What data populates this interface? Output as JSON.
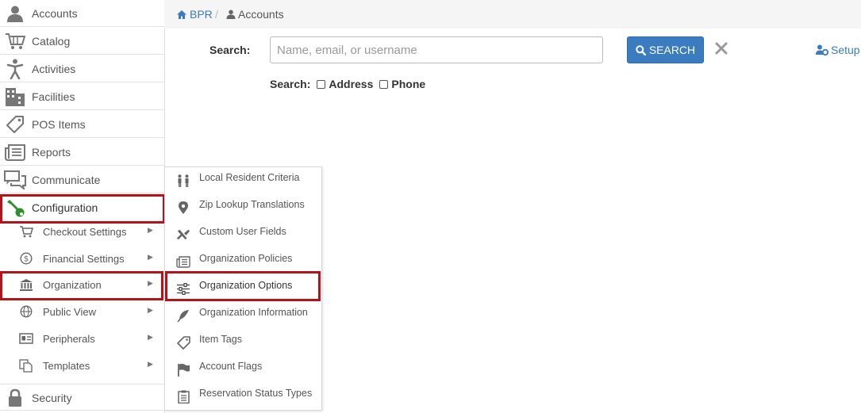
{
  "sidebar": {
    "items": [
      {
        "label": "Accounts",
        "icon": "user-icon"
      },
      {
        "label": "Catalog",
        "icon": "cart-icon"
      },
      {
        "label": "Activities",
        "icon": "person-activity-icon"
      },
      {
        "label": "Facilities",
        "icon": "building-icon"
      },
      {
        "label": "POS Items",
        "icon": "tag-icon"
      },
      {
        "label": "Reports",
        "icon": "reports-icon"
      },
      {
        "label": "Communicate",
        "icon": "chat-icon"
      },
      {
        "label": "Configuration",
        "icon": "wrench-icon"
      }
    ],
    "subitems": [
      {
        "label": "Checkout Settings",
        "icon": "cart-icon"
      },
      {
        "label": "Financial Settings",
        "icon": "dollar-icon"
      },
      {
        "label": "Organization",
        "icon": "bank-icon"
      },
      {
        "label": "Public View",
        "icon": "globe-icon"
      },
      {
        "label": "Peripherals",
        "icon": "id-card-icon"
      },
      {
        "label": "Templates",
        "icon": "copy-icon"
      }
    ],
    "security": {
      "label": "Security",
      "icon": "lock-icon"
    }
  },
  "breadcrumb": {
    "home": "BPR",
    "separator": "/",
    "current": "Accounts"
  },
  "search": {
    "label": "Search:",
    "placeholder": "Name, email, or username",
    "value": "",
    "button_label": "SEARCH",
    "options_label": "Search:",
    "address_label": "Address",
    "phone_label": "Phone"
  },
  "setup_label": "Setup",
  "flyout": {
    "items": [
      {
        "label": "Local Resident Criteria",
        "icon": "people-icon"
      },
      {
        "label": "Zip Lookup Translations",
        "icon": "map-pin-icon"
      },
      {
        "label": "Custom User Fields",
        "icon": "tools-icon"
      },
      {
        "label": "Organization Policies",
        "icon": "document-icon"
      },
      {
        "label": "Organization Options",
        "icon": "sliders-icon"
      },
      {
        "label": "Organization Information",
        "icon": "feather-icon"
      },
      {
        "label": "Item Tags",
        "icon": "tag-icon"
      },
      {
        "label": "Account Flags",
        "icon": "flag-icon"
      },
      {
        "label": "Reservation Status Types",
        "icon": "clipboard-icon"
      }
    ]
  },
  "colors": {
    "accent": "#3a7cbf",
    "highlight": "#b5121b",
    "config_icon": "#2e8b2e"
  }
}
